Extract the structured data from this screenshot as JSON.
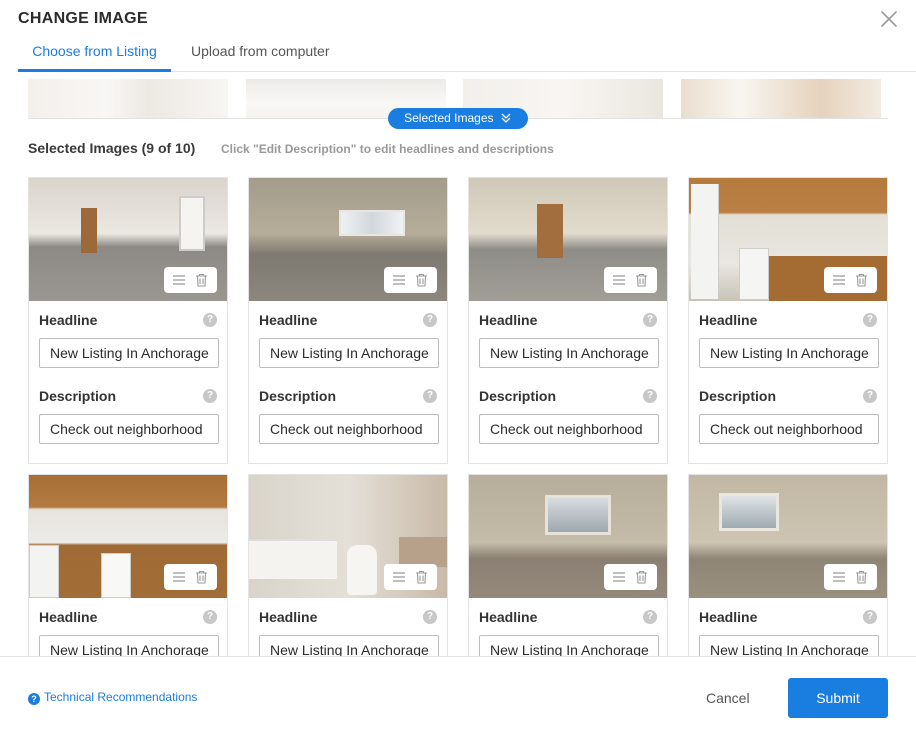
{
  "modal": {
    "title": "CHANGE IMAGE",
    "close_icon": "close-icon"
  },
  "tabs": [
    {
      "label": "Choose from Listing",
      "active": true
    },
    {
      "label": "Upload from computer",
      "active": false
    }
  ],
  "selected_pill": {
    "label": "Selected Images",
    "icon": "double-chevron-down-icon"
  },
  "selected": {
    "heading": "Selected Images (9 of 10)",
    "hint": "Click \"Edit Description\" to edit headlines and descriptions"
  },
  "card_labels": {
    "headline": "Headline",
    "description": "Description",
    "help": "?"
  },
  "cards": [
    {
      "headline": "New Listing In Anchorage",
      "description": "Check out neighborhood"
    },
    {
      "headline": "New Listing In Anchorage",
      "description": "Check out neighborhood"
    },
    {
      "headline": "New Listing In Anchorage",
      "description": "Check out neighborhood"
    },
    {
      "headline": "New Listing In Anchorage",
      "description": "Check out neighborhood"
    },
    {
      "headline": "New Listing In Anchorage"
    },
    {
      "headline": "New Listing In Anchorage"
    },
    {
      "headline": "New Listing In Anchorage"
    },
    {
      "headline": "New Listing In Anchorage"
    }
  ],
  "footer": {
    "tech_link": "Technical Recommendations",
    "tech_icon": "?",
    "cancel": "Cancel",
    "submit": "Submit"
  },
  "colors": {
    "accent": "#1a7de0",
    "help_icon": "#c7c7c7"
  }
}
